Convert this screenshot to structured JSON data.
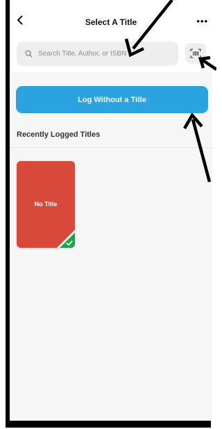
{
  "header": {
    "back_icon": "chevron-left-icon",
    "title": "Select A Title",
    "more_label": "•••"
  },
  "search": {
    "placeholder": "Search Title, Author, or ISBN",
    "value": "",
    "search_icon": "search-icon",
    "scan_icon": "barcode-scan-icon"
  },
  "actions": {
    "log_without_title": "Log Without a Title"
  },
  "recent": {
    "section_title": "Recently Logged Titles",
    "items": [
      {
        "label": "No Title",
        "color": "#d9493a",
        "selected": true,
        "badge_color": "#1fa34a"
      }
    ]
  },
  "colors": {
    "accent": "#2ba3e0",
    "background": "#f6f6f6"
  }
}
